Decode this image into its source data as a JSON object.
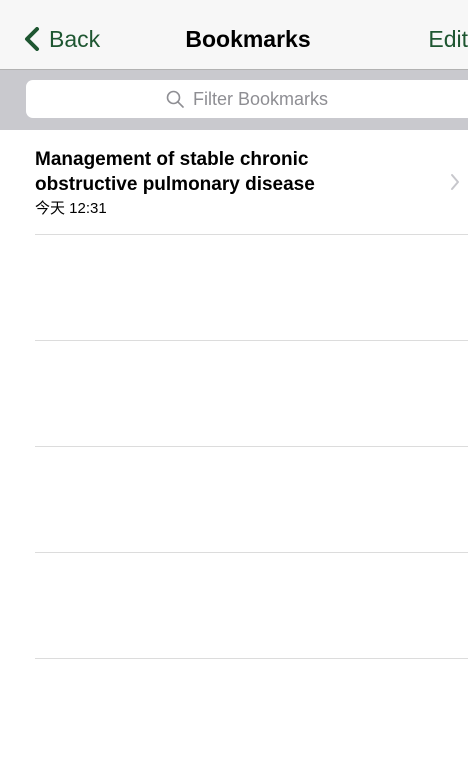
{
  "nav": {
    "back_label": "Back",
    "title": "Bookmarks",
    "edit_label": "Edit"
  },
  "search": {
    "placeholder": "Filter Bookmarks"
  },
  "bookmarks": [
    {
      "title": "Management of stable chronic obstructive pulmonary disease",
      "date": "今天 12:31"
    }
  ],
  "colors": {
    "accent": "#1e5631",
    "nav_background": "#f7f7f7",
    "search_background": "#c9c9ce",
    "placeholder": "#8e8e93",
    "separator": "#dcdcdc"
  },
  "icons": {
    "back": "chevron-left-icon",
    "search": "search-icon",
    "disclosure": "chevron-right-icon"
  }
}
